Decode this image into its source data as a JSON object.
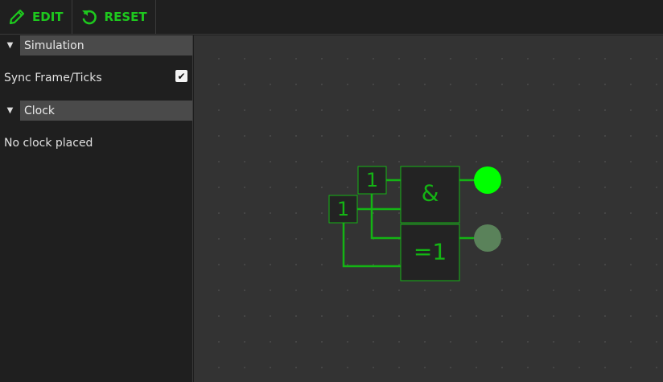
{
  "toolbar": {
    "edit_label": "EDIT",
    "reset_label": "RESET"
  },
  "sidebar": {
    "simulation": {
      "title": "Simulation",
      "sync_label": "Sync Frame/Ticks",
      "sync_checked": true
    },
    "clock": {
      "title": "Clock",
      "empty_text": "No clock placed"
    }
  },
  "circuit": {
    "input_top_label": "1",
    "input_left_label": "1",
    "and_gate_label": "&",
    "xor_gate_label": "=1",
    "output_and_state": "on",
    "output_xor_state": "off"
  },
  "colors": {
    "accent": "#1ec81e",
    "wire": "#14b414",
    "led_on": "#00ff00",
    "led_off": "#5a825a",
    "canvas_bg": "#333333"
  }
}
